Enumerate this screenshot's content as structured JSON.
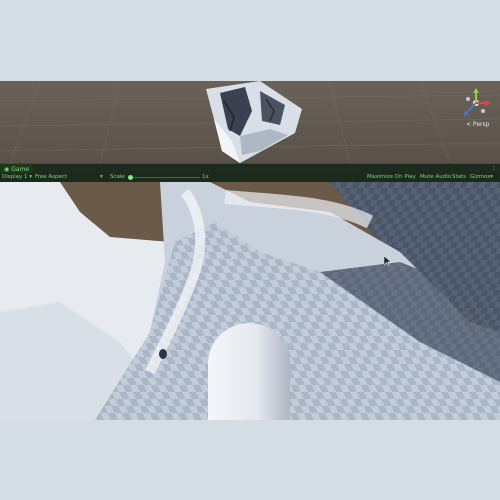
{
  "scene": {
    "persp_label": "< Persp",
    "gizmo_icon": "axis-gizmo-icon"
  },
  "game_tab": {
    "label": "Game",
    "icon": "gamepad-icon",
    "menu_icon": "kebab-menu-icon"
  },
  "toolbar": {
    "display": "Display 1",
    "aspect": "Free Aspect",
    "scale_label": "Scale",
    "scale_value": "1x",
    "maximize": "Maximize On Play",
    "mute": "Mute Audio",
    "stats": "Stats",
    "gizmos": "Gizmos"
  },
  "colors": {
    "accent": "#7ce07a",
    "scene_bg": "#625a50",
    "terrain": "#b9c4d3",
    "sky_bg": "#d5dde4"
  }
}
